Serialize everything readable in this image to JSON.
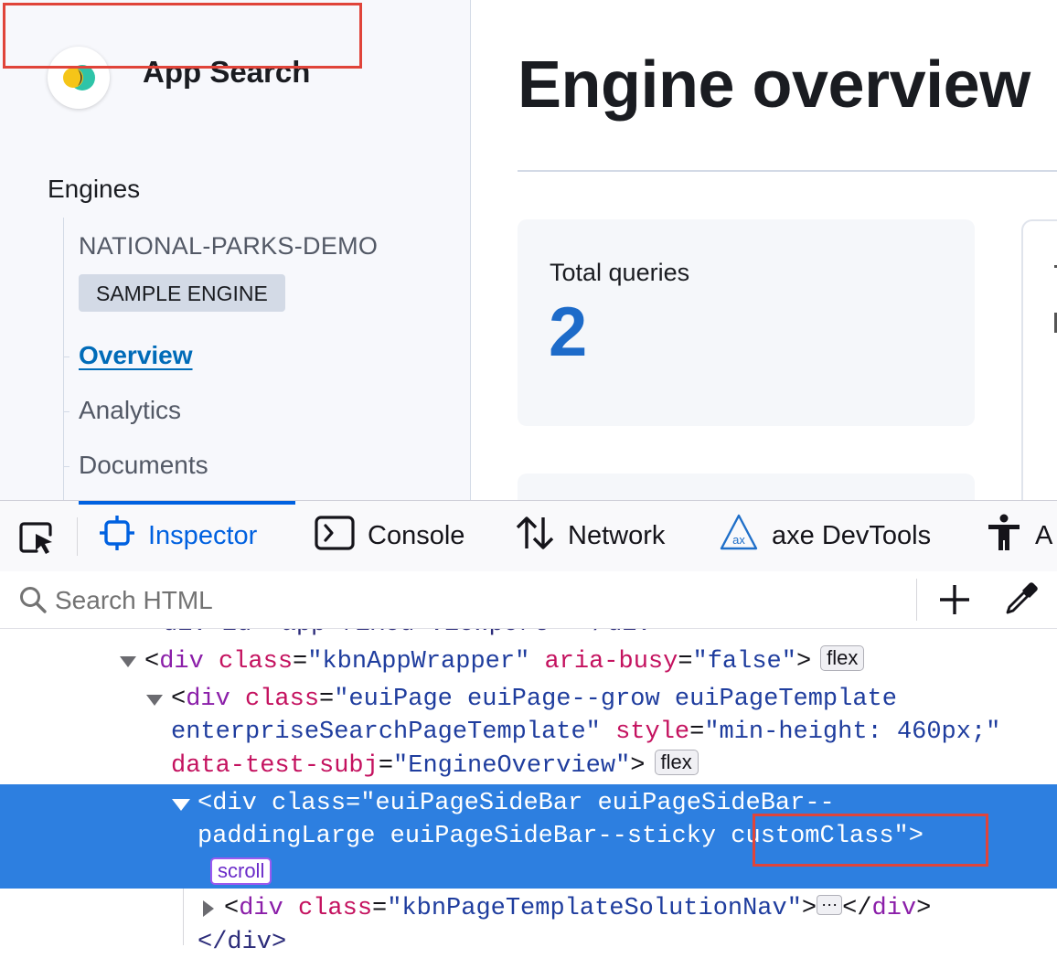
{
  "app": {
    "title": "App Search",
    "engines_label": "Engines",
    "engine_name": "NATIONAL-PARKS-DEMO",
    "engine_badge": "SAMPLE ENGINE",
    "nav": [
      {
        "label": "Overview",
        "active": true
      },
      {
        "label": "Analytics",
        "active": false
      },
      {
        "label": "Documents",
        "active": false
      }
    ],
    "page_title": "Engine overview",
    "stat": {
      "label": "Total queries",
      "value": "2"
    },
    "brand_color": "#006bb8"
  },
  "devtools": {
    "tabs": [
      {
        "label": "Inspector",
        "icon": "inspector-icon",
        "active": true
      },
      {
        "label": "Console",
        "icon": "console-icon"
      },
      {
        "label": "Network",
        "icon": "network-icon"
      },
      {
        "label": "axe DevTools",
        "icon": "axe-icon"
      },
      {
        "label": "A",
        "icon": "accessibility-icon"
      }
    ],
    "search_placeholder": "Search HTML",
    "accent": "#0061e0"
  },
  "tree": {
    "line0": "div id=\"app-fixed-viewport\"></div>",
    "l1": {
      "tag": "div",
      "a1": "class",
      "v1": "\"kbnAppWrapper\"",
      "a2": "aria-busy",
      "v2": "\"false\"",
      "badge": "flex"
    },
    "l2": {
      "tag": "div",
      "a1": "class",
      "v1a": "\"euiPage euiPage--grow euiPageTemplate",
      "v1b": "enterpriseSearchPageTemplate\"",
      "a2": "style",
      "v2": "\"min-height: 460px;\"",
      "a3": "data-test-subj",
      "v3": "\"EngineOverview\"",
      "badge": "flex"
    },
    "l3": {
      "tag": "div",
      "a1": "class",
      "v1a": "\"euiPageSideBar euiPageSideBar--",
      "v1b": "paddingLarge euiPageSideBar--sticky",
      "v1c": "customClass\"",
      "badge": "scroll"
    },
    "l4": {
      "tag": "div",
      "a1": "class",
      "v1": "\"kbnPageTemplateSolutionNav\"",
      "ellipsis": "⋯"
    },
    "l5": "</div>"
  },
  "highlight_color": "#e0443a"
}
